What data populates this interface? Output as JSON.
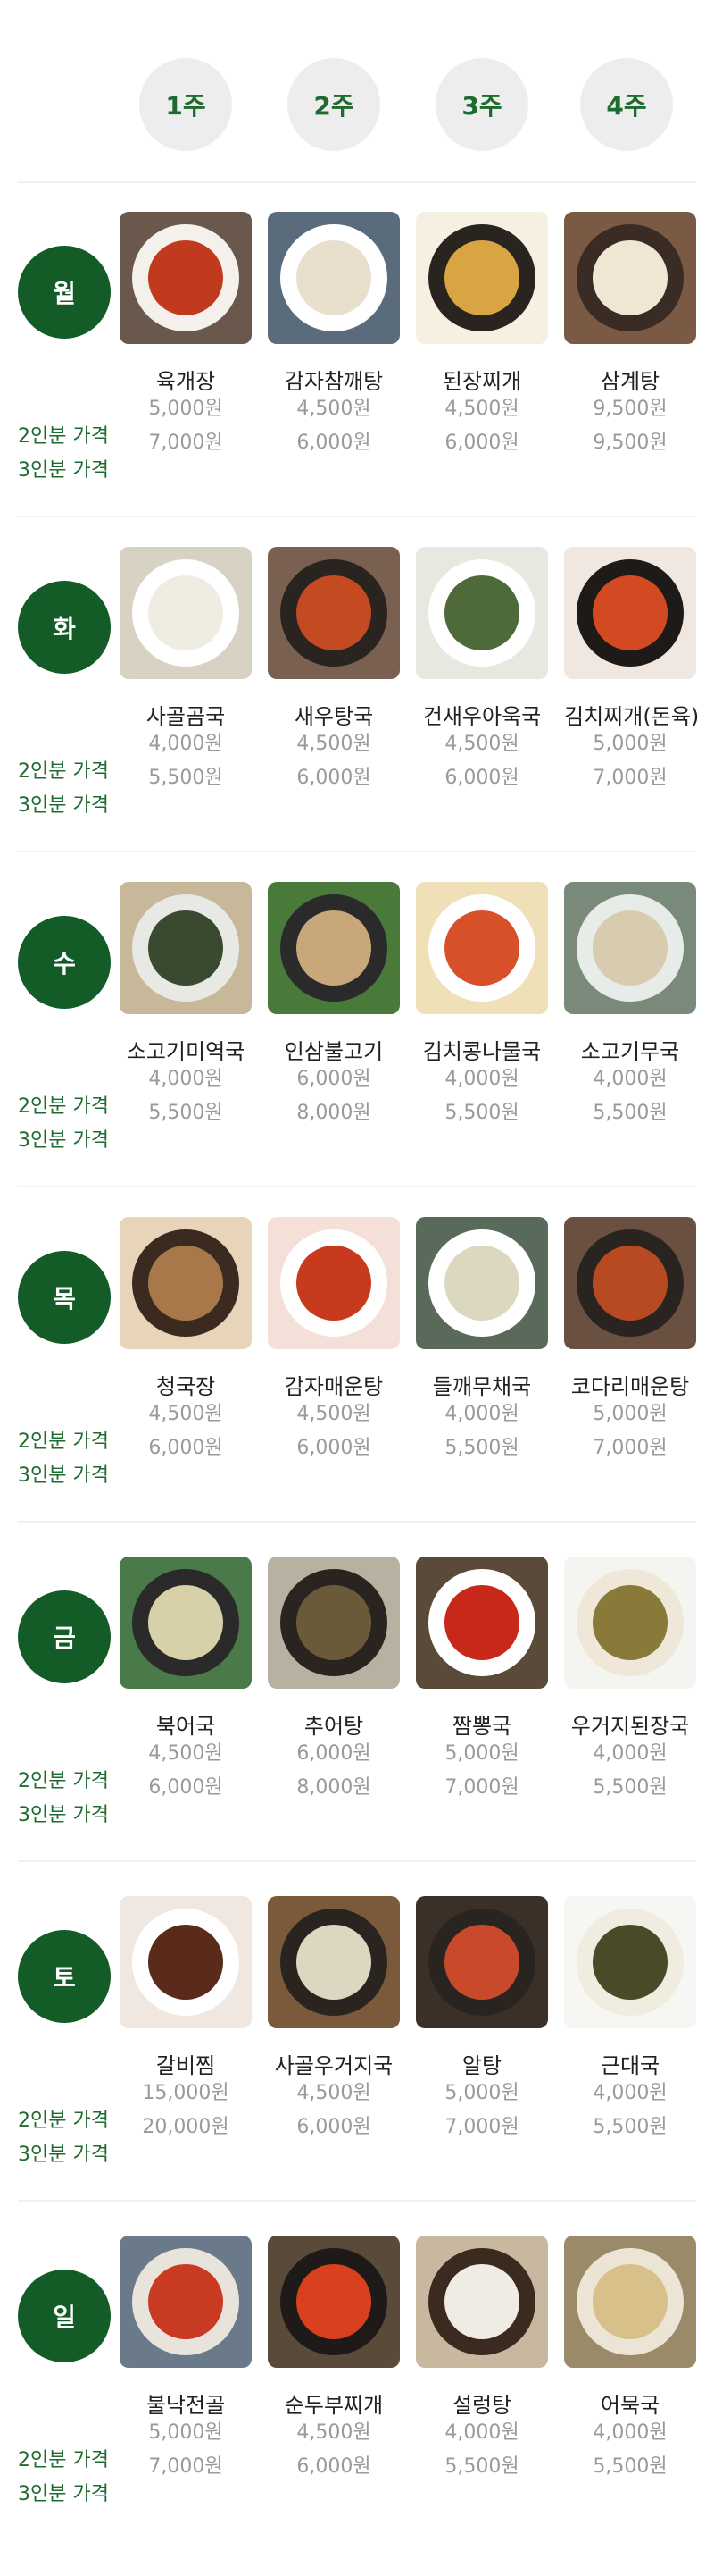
{
  "weeks": [
    "1주",
    "2주",
    "3주",
    "4주"
  ],
  "price_labels": {
    "two": "2인분 가격",
    "three": "3인분 가격"
  },
  "colors": {
    "accent": "#135c27",
    "week_bg": "#ededed",
    "price": "#9a9a9a"
  },
  "days": [
    {
      "day": "월",
      "dishes": [
        {
          "name": "육개장",
          "price2": "5,000원",
          "price3": "7,000원",
          "icon": "spicy-beef-soup-photo",
          "bowl": "#f4f1ec",
          "soup": "#c23a1e",
          "bg": "#6a584c"
        },
        {
          "name": "감자참깨탕",
          "price2": "4,500원",
          "price3": "6,000원",
          "icon": "potato-sesame-soup-photo",
          "bowl": "#ffffff",
          "soup": "#e8e0cc",
          "bg": "#5a6c7c"
        },
        {
          "name": "된장찌개",
          "price2": "4,500원",
          "price3": "6,000원",
          "icon": "soybean-paste-stew-photo",
          "bowl": "#2a2420",
          "soup": "#d9a543",
          "bg": "#f6f0e2"
        },
        {
          "name": "삼계탕",
          "price2": "9,500원",
          "price3": "9,500원",
          "icon": "ginseng-chicken-soup-photo",
          "bowl": "#3a2c24",
          "soup": "#efe7d4",
          "bg": "#7a5a44"
        }
      ]
    },
    {
      "day": "화",
      "dishes": [
        {
          "name": "사골곰국",
          "price2": "4,000원",
          "price3": "5,500원",
          "icon": "bone-broth-soup-photo",
          "bowl": "#ffffff",
          "soup": "#efece2",
          "bg": "#d8d2c4"
        },
        {
          "name": "새우탕국",
          "price2": "4,500원",
          "price3": "6,000원",
          "icon": "shrimp-soup-photo",
          "bowl": "#2a2420",
          "soup": "#c44a22",
          "bg": "#7a6050"
        },
        {
          "name": "건새우아욱국",
          "price2": "4,500원",
          "price3": "6,000원",
          "icon": "dried-shrimp-mallow-soup-photo",
          "bowl": "#ffffff",
          "soup": "#4e6a3a",
          "bg": "#e8e8e0"
        },
        {
          "name": "김치찌개(돈육)",
          "price2": "5,000원",
          "price3": "7,000원",
          "icon": "pork-kimchi-stew-photo",
          "bowl": "#1e1a18",
          "soup": "#d34a22",
          "bg": "#f0e8e0"
        }
      ]
    },
    {
      "day": "수",
      "dishes": [
        {
          "name": "소고기미역국",
          "price2": "4,000원",
          "price3": "5,500원",
          "icon": "beef-seaweed-soup-photo",
          "bowl": "#e8e8e4",
          "soup": "#3a4a30",
          "bg": "#c8b89a"
        },
        {
          "name": "인삼불고기",
          "price2": "6,000원",
          "price3": "8,000원",
          "icon": "ginseng-bulgogi-photo",
          "bowl": "#2a2a2a",
          "soup": "#c8a87a",
          "bg": "#4a7a3a"
        },
        {
          "name": "김치콩나물국",
          "price2": "4,000원",
          "price3": "5,500원",
          "icon": "kimchi-bean-sprout-soup-photo",
          "bowl": "#ffffff",
          "soup": "#d8502a",
          "bg": "#efe0b8"
        },
        {
          "name": "소고기무국",
          "price2": "4,000원",
          "price3": "5,500원",
          "icon": "beef-radish-soup-photo",
          "bowl": "#e8ece8",
          "soup": "#d8ccb0",
          "bg": "#7a8a7a"
        }
      ]
    },
    {
      "day": "목",
      "dishes": [
        {
          "name": "청국장",
          "price2": "4,500원",
          "price3": "6,000원",
          "icon": "rich-soybean-stew-photo",
          "bowl": "#3a2a20",
          "soup": "#a8784a",
          "bg": "#e8d4b8"
        },
        {
          "name": "감자매운탕",
          "price2": "4,500원",
          "price3": "6,000원",
          "icon": "spicy-potato-stew-photo",
          "bowl": "#ffffff",
          "soup": "#c83a1e",
          "bg": "#f4e0d8"
        },
        {
          "name": "들깨무채국",
          "price2": "4,000원",
          "price3": "5,500원",
          "icon": "perilla-radish-soup-photo",
          "bowl": "#ffffff",
          "soup": "#dcd8c0",
          "bg": "#5a6a5a"
        },
        {
          "name": "코다리매운탕",
          "price2": "5,000원",
          "price3": "7,000원",
          "icon": "spicy-pollack-stew-photo",
          "bowl": "#2a2420",
          "soup": "#b84a22",
          "bg": "#6a5040"
        }
      ]
    },
    {
      "day": "금",
      "dishes": [
        {
          "name": "북어국",
          "price2": "4,500원",
          "price3": "6,000원",
          "icon": "dried-pollack-soup-photo",
          "bowl": "#2a2a2a",
          "soup": "#d8d0a8",
          "bg": "#4a7a4a"
        },
        {
          "name": "추어탕",
          "price2": "6,000원",
          "price3": "8,000원",
          "icon": "loach-soup-photo",
          "bowl": "#2a2420",
          "soup": "#6a5a3a",
          "bg": "#b8b0a0"
        },
        {
          "name": "짬뽕국",
          "price2": "5,000원",
          "price3": "7,000원",
          "icon": "spicy-seafood-noodle-soup-photo",
          "bowl": "#ffffff",
          "soup": "#c8281a",
          "bg": "#5a4a3a"
        },
        {
          "name": "우거지된장국",
          "price2": "4,000원",
          "price3": "5,500원",
          "icon": "cabbage-soybean-soup-photo",
          "bowl": "#efe8d8",
          "soup": "#8a7a3a",
          "bg": "#f4f4f0"
        }
      ]
    },
    {
      "day": "토",
      "dishes": [
        {
          "name": "갈비찜",
          "price2": "15,000원",
          "price3": "20,000원",
          "icon": "braised-short-ribs-photo",
          "bowl": "#ffffff",
          "soup": "#5a2a1a",
          "bg": "#f0e8e0"
        },
        {
          "name": "사골우거지국",
          "price2": "4,500원",
          "price3": "6,000원",
          "icon": "bone-broth-cabbage-soup-photo",
          "bowl": "#2a2420",
          "soup": "#ddd6c0",
          "bg": "#7a5a3a"
        },
        {
          "name": "알탕",
          "price2": "5,000원",
          "price3": "7,000원",
          "icon": "fish-roe-stew-photo",
          "bowl": "#2a2420",
          "soup": "#c84a2a",
          "bg": "#3a3028"
        },
        {
          "name": "근대국",
          "price2": "4,000원",
          "price3": "5,500원",
          "icon": "chard-soup-photo",
          "bowl": "#f0ece0",
          "soup": "#4a4a28",
          "bg": "#f6f6f2"
        }
      ]
    },
    {
      "day": "일",
      "dishes": [
        {
          "name": "불낙전골",
          "price2": "5,000원",
          "price3": "7,000원",
          "icon": "bulgogi-octopus-hotpot-photo",
          "bowl": "#e8e4dc",
          "soup": "#c83a22",
          "bg": "#6a7a8a"
        },
        {
          "name": "순두부찌개",
          "price2": "4,500원",
          "price3": "6,000원",
          "icon": "soft-tofu-stew-photo",
          "bowl": "#1e1a18",
          "soup": "#d8401e",
          "bg": "#5a4a3a"
        },
        {
          "name": "설렁탕",
          "price2": "4,000원",
          "price3": "5,500원",
          "icon": "ox-bone-soup-photo",
          "bowl": "#3a2a20",
          "soup": "#efece4",
          "bg": "#c8b8a0"
        },
        {
          "name": "어묵국",
          "price2": "4,000원",
          "price3": "5,500원",
          "icon": "fish-cake-soup-photo",
          "bowl": "#ece4d4",
          "soup": "#d8c08a",
          "bg": "#9a8a6a"
        }
      ]
    }
  ]
}
